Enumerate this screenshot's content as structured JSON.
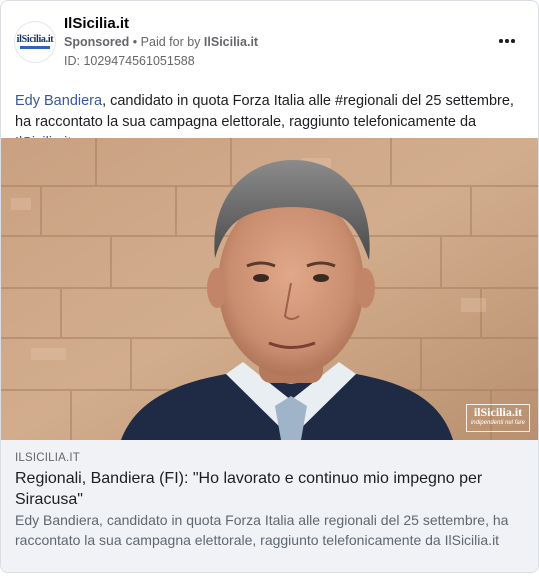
{
  "header": {
    "page_name": "IlSicilia.it",
    "sponsored_label": "Sponsored",
    "separator": "•",
    "paid_for_prefix": "Paid for by",
    "payer": "IlSicilia.it",
    "ad_id": "ID: 1029474561051588",
    "avatar_logo_text": "ilSicilia.it",
    "more_icon": "more-horizontal-icon"
  },
  "post": {
    "text_link_name": "Edy Bandiera",
    "text_middle": ", candidato in quota Forza Italia alle #regionali del 25 settembre, ha raccontato la sua campagna elettorale, raggiunto telefonicamente da ",
    "text_link_site": "IlSicilia.it"
  },
  "image": {
    "watermark_title": "ilSicilia.it",
    "watermark_sub": "indipendenti nel fare"
  },
  "link_preview": {
    "domain": "ILSICILIA.IT",
    "headline": "Regionali, Bandiera (FI): \"Ho lavorato e continuo mio impegno per Siracusa\"",
    "description": "Edy Bandiera, candidato in quota Forza Italia alle regionali del 25 settembre, ha raccontato la sua campagna elettorale, raggiunto telefonicamente da IlSicilia.it"
  },
  "colors": {
    "link_blue": "#385898",
    "secondary_text": "#65676b",
    "preview_bg": "#f0f2f5"
  }
}
